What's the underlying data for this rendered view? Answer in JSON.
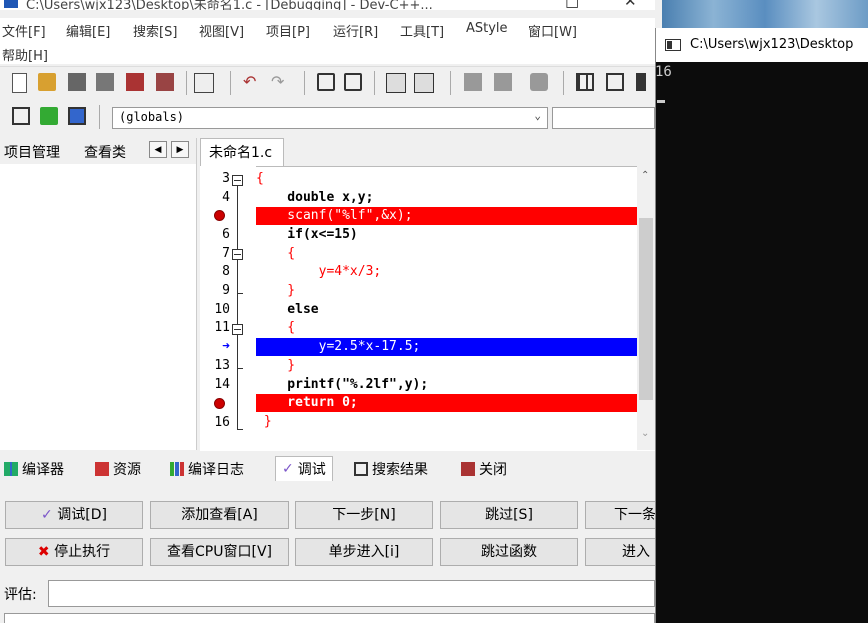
{
  "window": {
    "title": "C:\\Users\\wjx123\\Desktop\\未命名1.c - [Debugging] - Dev-C++..."
  },
  "menu": {
    "items": [
      "文件[F]",
      "编辑[E]",
      "搜索[S]",
      "视图[V]",
      "项目[P]",
      "运行[R]",
      "工具[T]",
      "AStyle",
      "窗口[W]",
      "帮助[H]"
    ]
  },
  "toolbar2": {
    "scope_select": "(globals)"
  },
  "left_panel": {
    "tabs": [
      "项目管理",
      "查看类"
    ]
  },
  "editor": {
    "tab": "未命名1.c",
    "lines": [
      {
        "num": "3",
        "code": "{"
      },
      {
        "num": "4",
        "code": "    double x,y;"
      },
      {
        "num": "5",
        "code": "    scanf(\"%lf\",&x);"
      },
      {
        "num": "6",
        "code": "    if(x<=15)"
      },
      {
        "num": "7",
        "code": "    {"
      },
      {
        "num": "8",
        "code": "        y=4*x/3;"
      },
      {
        "num": "9",
        "code": "    }"
      },
      {
        "num": "10",
        "code": "    else"
      },
      {
        "num": "11",
        "code": "    {"
      },
      {
        "num": "12",
        "code": "        y=2.5*x-17.5;"
      },
      {
        "num": "13",
        "code": "    }"
      },
      {
        "num": "14",
        "code": "    printf(\"%.2lf\",y);"
      },
      {
        "num": "15",
        "code": "    return 0;"
      },
      {
        "num": "16",
        "code": " }"
      }
    ]
  },
  "bottom_tabs": [
    "编译器",
    "资源",
    "编译日志",
    "调试",
    "搜索结果",
    "关闭"
  ],
  "debug": {
    "buttons_row1": [
      "调试[D]",
      "添加查看[A]",
      "下一步[N]",
      "跳过[S]",
      "下一条"
    ],
    "buttons_row2": [
      "停止执行",
      "查看CPU窗口[V]",
      "单步进入[i]",
      "跳过函数",
      "进入"
    ],
    "eval_label": "评估:"
  },
  "console": {
    "title": "C:\\Users\\wjx123\\Desktop",
    "output": "16"
  },
  "colors": {
    "breakpoint_line": "#ff0000",
    "current_line": "#0000ff",
    "console_bg": "#0c0c0c"
  }
}
